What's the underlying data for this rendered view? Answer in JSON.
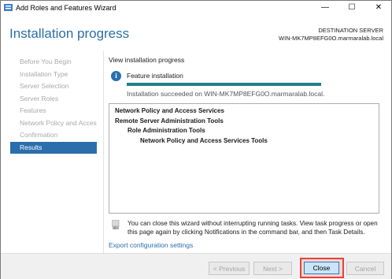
{
  "window": {
    "title": "Add Roles and Features Wizard",
    "controls": {
      "minimize": "—",
      "maximize": "☐",
      "close": "✕"
    }
  },
  "header": {
    "page_title": "Installation progress",
    "destination_label": "DESTINATION SERVER",
    "destination_server": "WIN-MK7MP8EFG0O.marmaralab.local"
  },
  "nav": {
    "items": [
      {
        "label": "Before You Begin",
        "active": false
      },
      {
        "label": "Installation Type",
        "active": false
      },
      {
        "label": "Server Selection",
        "active": false
      },
      {
        "label": "Server Roles",
        "active": false
      },
      {
        "label": "Features",
        "active": false
      },
      {
        "label": "Network Policy and Acces...",
        "active": false
      },
      {
        "label": "Confirmation",
        "active": false
      },
      {
        "label": "Results",
        "active": true
      }
    ]
  },
  "main": {
    "title": "View installation progress",
    "feature_label": "Feature installation",
    "progress_fraction": 1.0,
    "success_text": "Installation succeeded on WIN-MK7MP8EFG0O.marmaralab.local.",
    "results": [
      {
        "text": "Network Policy and Access Services",
        "level": 0
      },
      {
        "text": "Remote Server Administration Tools",
        "level": 0
      },
      {
        "text": "Role Administration Tools",
        "level": 1
      },
      {
        "text": "Network Policy and Access Services Tools",
        "level": 2
      }
    ],
    "note": "You can close this wizard without interrupting running tasks. View task progress or open this page again by clicking Notifications in the command bar, and then Task Details.",
    "export_link": "Export configuration settings"
  },
  "footer": {
    "previous_label": "< Previous",
    "next_label": "Next >",
    "close_label": "Close",
    "cancel_label": "Cancel"
  },
  "colors": {
    "accent": "#2a6fac",
    "progress": "#1f7f8c",
    "highlight": "#e0453a"
  }
}
